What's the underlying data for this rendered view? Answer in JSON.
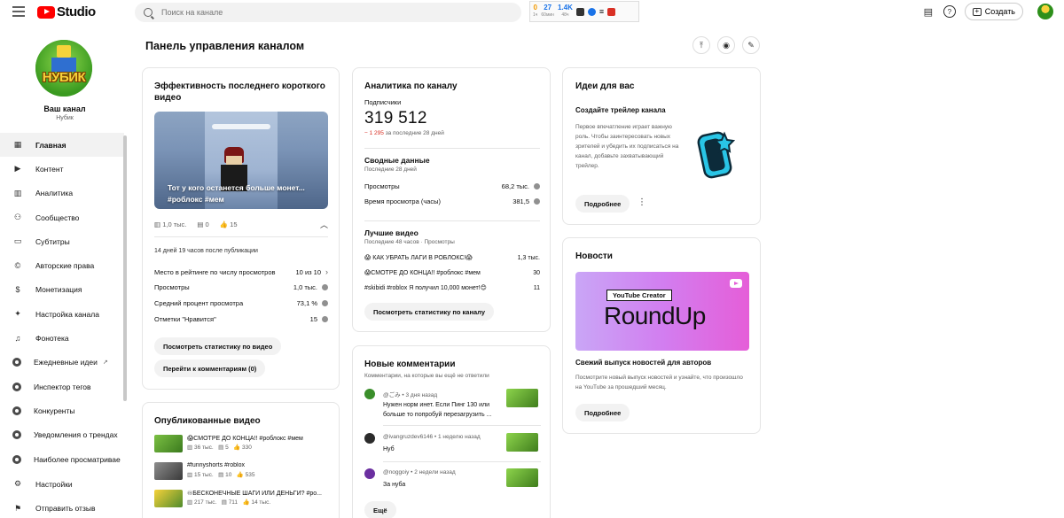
{
  "header": {
    "logo_text": "Studio",
    "search_placeholder": "Поиск на канале",
    "ext": {
      "s1_val": "0",
      "s1_lbl": "1ч",
      "s2_val": "27",
      "s2_lbl": "60мин",
      "s3_val": "1.4K",
      "s3_lbl": "48ч"
    },
    "create_label": "Создать"
  },
  "sidebar": {
    "channel_name": "Ваш канал",
    "channel_handle": "Нубик",
    "avatar_text": "НУБИК",
    "items": [
      {
        "label": "Главная",
        "icon": "dashboard-icon"
      },
      {
        "label": "Контент",
        "icon": "content-icon"
      },
      {
        "label": "Аналитика",
        "icon": "analytics-icon"
      },
      {
        "label": "Сообщество",
        "icon": "community-icon"
      },
      {
        "label": "Субтитры",
        "icon": "subtitles-icon"
      },
      {
        "label": "Авторские права",
        "icon": "copyright-icon"
      },
      {
        "label": "Монетизация",
        "icon": "monetization-icon"
      },
      {
        "label": "Настройка канала",
        "icon": "customization-icon"
      },
      {
        "label": "Фонотека",
        "icon": "audio-library-icon"
      },
      {
        "label": "Ежедневные идеи",
        "icon": "daily-ideas-icon"
      },
      {
        "label": "Инспектор тегов",
        "icon": "tag-inspector-icon"
      },
      {
        "label": "Конкуренты",
        "icon": "competitors-icon"
      },
      {
        "label": "Уведомления о трендах",
        "icon": "trend-alerts-icon"
      },
      {
        "label": "Наиболее просматривае",
        "icon": "most-viewed-icon"
      },
      {
        "label": "Настройки",
        "icon": "settings-icon"
      },
      {
        "label": "Отправить отзыв",
        "icon": "feedback-icon"
      }
    ]
  },
  "main": {
    "title": "Панель управления каналом"
  },
  "last_short": {
    "title": "Эффективность последнего короткого видео",
    "thumb_text": "Тот у кого останется больше монет... #роблокс #мем",
    "views": "1,0 тыс.",
    "comments": "0",
    "likes": "15",
    "since": "14 дней 19 часов после публикации",
    "rows": [
      {
        "label": "Место в рейтинге по числу просмотров",
        "value": "10 из 10"
      },
      {
        "label": "Просмотры",
        "value": "1,0 тыс."
      },
      {
        "label": "Средний процент просмотра",
        "value": "73,1 %"
      },
      {
        "label": "Отметки \"Нравится\"",
        "value": "15"
      }
    ],
    "btn_stats": "Посмотреть статистику по видео",
    "btn_comments": "Перейти к комментариям (0)"
  },
  "published": {
    "title": "Опубликованные видео",
    "items": [
      {
        "title": "😱СМОТРЕ ДО КОНЦА!! #роблокс #мем",
        "views": "36 тыс.",
        "comments": "5",
        "likes": "330"
      },
      {
        "title": "#funnyshorts #roblox",
        "views": "15 тыс.",
        "comments": "10",
        "likes": "535"
      },
      {
        "title": "♾БЕСКОНЕЧНЫЕ ШАГИ ИЛИ ДЕНЬГИ? #ро...",
        "views": "217 тыс.",
        "comments": "711",
        "likes": "14 тыс."
      }
    ]
  },
  "analytics": {
    "title": "Аналитика по каналу",
    "subs_label": "Подписчики",
    "subs_value": "319 512",
    "subs_delta": "− 1 295",
    "subs_delta_suffix": "за последние 28 дней",
    "summary_title": "Сводные данные",
    "summary_sub": "Последние 28 дней",
    "summary_rows": [
      {
        "label": "Просмотры",
        "value": "68,2 тыс."
      },
      {
        "label": "Время просмотра (часы)",
        "value": "381,5"
      }
    ],
    "top_title": "Лучшие видео",
    "top_sub": "Последние 48 часов · Просмотры",
    "top_rows": [
      {
        "label": "😱 КАК УБРАТЬ ЛАГИ В РОБЛОКС!😱",
        "value": "1,3 тыс."
      },
      {
        "label": "😱СМОТРЕ ДО КОНЦА!! #роблокс #мем",
        "value": "30"
      },
      {
        "label": "#skibidi #roblox Я получил 10,000 монет!😊",
        "value": "11"
      }
    ],
    "btn": "Посмотреть статистику по каналу"
  },
  "comments": {
    "title": "Новые комментарии",
    "subtitle": "Комментарии, на которые вы ещё не ответили",
    "items": [
      {
        "author": "@ごみ",
        "time": "3 дня назад",
        "text": "Нужен норм инет. Если Пинг 130 или больше то попробуй перезагрузить ..."
      },
      {
        "author": "@ivangruzdev6146",
        "time": "1 неделю назад",
        "text": "Нуб"
      },
      {
        "author": "@noggoiy",
        "time": "2 недели назад",
        "text": "За нуба"
      }
    ],
    "btn": "Ещё"
  },
  "ideas": {
    "title": "Идеи для вас",
    "subtitle": "Создайте трейлер канала",
    "text": "Первое впечатление играет важную роль. Чтобы заинтересовать новых зрителей и убедить их подписаться на канал, добавьте захватывающий трейлер.",
    "btn": "Подробнее"
  },
  "news": {
    "title": "Новости",
    "img_label": "YouTube Creator",
    "img_title": "RoundUp",
    "headline": "Свежий выпуск новостей для авторов",
    "text": "Посмотрите новый выпуск новостей и узнайте, что произошло на YouTube за прошедший месяц.",
    "btn": "Подробнее"
  }
}
